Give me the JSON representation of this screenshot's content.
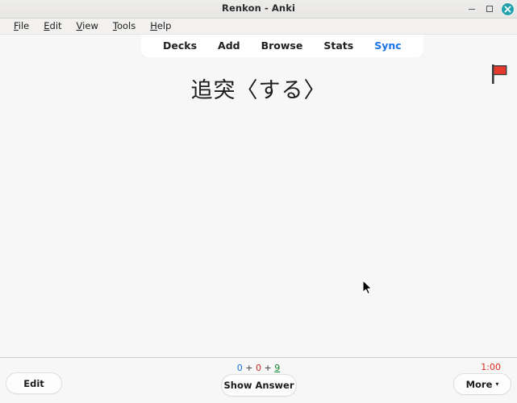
{
  "window": {
    "title": "Renkon - Anki",
    "controls": {
      "minimize": "minimize-icon",
      "maximize": "maximize-icon",
      "close": "close-icon"
    },
    "close_color": "#22a0ad"
  },
  "menubar": {
    "items": [
      {
        "label": "File",
        "mnemonic": "F",
        "rest": "ile"
      },
      {
        "label": "Edit",
        "mnemonic": "E",
        "rest": "dit"
      },
      {
        "label": "View",
        "mnemonic": "V",
        "rest": "iew"
      },
      {
        "label": "Tools",
        "mnemonic": "T",
        "rest": "ools"
      },
      {
        "label": "Help",
        "mnemonic": "H",
        "rest": "elp"
      }
    ]
  },
  "nav": {
    "items": [
      {
        "label": "Decks",
        "active": false
      },
      {
        "label": "Add",
        "active": false
      },
      {
        "label": "Browse",
        "active": false
      },
      {
        "label": "Stats",
        "active": false
      },
      {
        "label": "Sync",
        "active": true
      }
    ],
    "active_color": "#1a73e8"
  },
  "card": {
    "question": "追突〈する〉",
    "flag": {
      "name": "red-flag-icon",
      "color": "#e8392f"
    }
  },
  "bottom": {
    "edit_label": "Edit",
    "show_answer_label": "Show Answer",
    "more_label": "More",
    "more_caret": "▾",
    "counts": {
      "new": "0",
      "learning": "0",
      "review": "9",
      "separator": " + ",
      "new_color": "#1a6fd4",
      "learning_color": "#d42b1f",
      "review_color": "#12852f"
    },
    "timer": "1:00",
    "timer_color": "#e02a1a"
  }
}
